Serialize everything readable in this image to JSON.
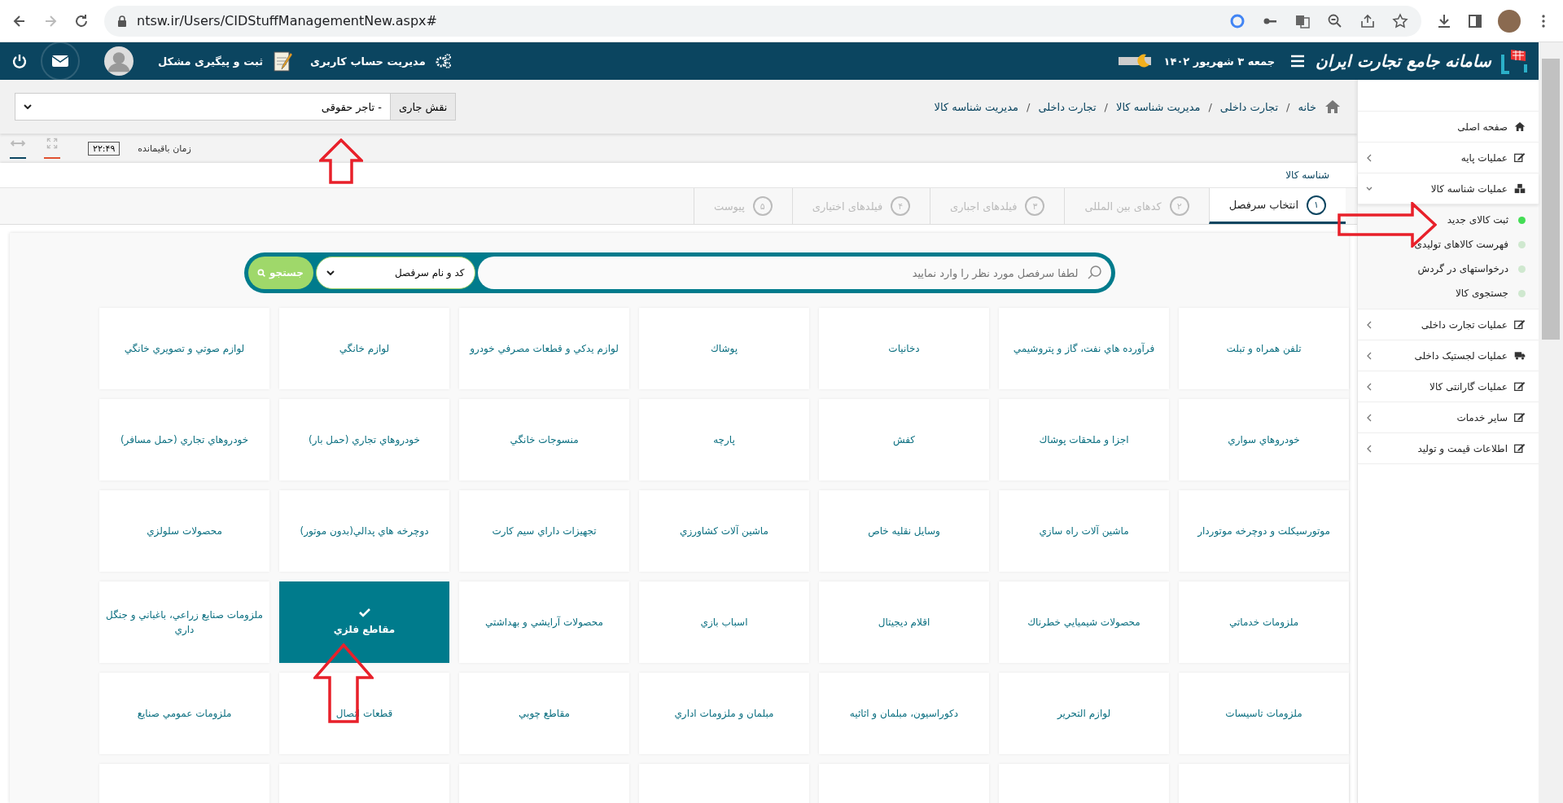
{
  "browser": {
    "url": "ntsw.ir/Users/CIDStuffManagementNew.aspx#"
  },
  "header": {
    "logo": "سامانه جامع تجارت ایران",
    "dark_mode": true,
    "date": "جمعه ۳ شهریور ۱۴۰۲",
    "links": [
      "مدیریت حساب کاربری",
      "ثبت و پیگیری مشکل"
    ]
  },
  "breadcrumb_separator": "/",
  "breadcrumb": [
    "خانه",
    "تجارت داخلی",
    "مدیریت شناسه کالا",
    "تجارت داخلی",
    "مدیریت شناسه کالا"
  ],
  "role": {
    "label": "نقش جاری",
    "value": "تاجر حقوقی -"
  },
  "timer": {
    "label": "زمان باقیمانده",
    "value": "۲۲:۴۹"
  },
  "panel_title": "شناسه کالا",
  "steps": [
    {
      "number": "١",
      "label": "انتخاب سرفصل",
      "selected": true
    },
    {
      "number": "۲",
      "label": "کدهای بین المللی",
      "selected": false
    },
    {
      "number": "۳",
      "label": "فیلدهای اجباری",
      "selected": false
    },
    {
      "number": "۴",
      "label": "فیلدهای اختیاری",
      "selected": false
    },
    {
      "number": "۵",
      "label": "پیوست",
      "selected": false
    }
  ],
  "search": {
    "placeholder": "لطفا سرفصل مورد نظر را وارد نمایید",
    "filter": "کد و نام سرفصل",
    "button": "جستجو"
  },
  "categories": [
    {
      "label": "تلفن همراه و تبلت",
      "selected": false
    },
    {
      "label": "فرآورده هاي نفت، گاز و پتروشيمي",
      "selected": false
    },
    {
      "label": "دخانيات",
      "selected": false
    },
    {
      "label": "پوشاك",
      "selected": false
    },
    {
      "label": "لوازم يدكي و قطعات مصرفي خودرو",
      "selected": false
    },
    {
      "label": "لوازم خانگي",
      "selected": false
    },
    {
      "label": "لوازم صوتي و تصويري خانگي",
      "selected": false
    },
    {
      "label": "خودروهاي سواري",
      "selected": false
    },
    {
      "label": "اجزا و ملحقات پوشاك",
      "selected": false
    },
    {
      "label": "كفش",
      "selected": false
    },
    {
      "label": "پارچه",
      "selected": false
    },
    {
      "label": "منسوجات خانگي",
      "selected": false
    },
    {
      "label": "خودروهاي تجاري (حمل بار)",
      "selected": false
    },
    {
      "label": "خودروهاي تجاري (حمل مسافر)",
      "selected": false
    },
    {
      "label": "موتورسيكلت و دوچرخه موتوردار",
      "selected": false
    },
    {
      "label": "ماشين آلات راه سازي",
      "selected": false
    },
    {
      "label": "وسايل نقليه خاص",
      "selected": false
    },
    {
      "label": "ماشين آلات كشاورزي",
      "selected": false
    },
    {
      "label": "تجهيزات داراي سيم كارت",
      "selected": false
    },
    {
      "label": "دوچرخه هاي پدالي(بدون موتور)",
      "selected": false
    },
    {
      "label": "محصولات سلولزي",
      "selected": false
    },
    {
      "label": "ملزومات خدماتي",
      "selected": false
    },
    {
      "label": "محصولات شيميايي خطرناك",
      "selected": false
    },
    {
      "label": "اقلام ديجيتال",
      "selected": false
    },
    {
      "label": "اسباب بازي",
      "selected": false
    },
    {
      "label": "محصولات آرايشي و بهداشتي",
      "selected": false
    },
    {
      "label": "مقاطع فلزي",
      "selected": true
    },
    {
      "label": "ملزومات صنايع زراعي، باغباني و جنگل داري",
      "selected": false
    },
    {
      "label": "ملزومات تاسيسات",
      "selected": false
    },
    {
      "label": "لوازم التحرير",
      "selected": false
    },
    {
      "label": "دكوراسيون، مبلمان و اثاثيه",
      "selected": false
    },
    {
      "label": "مبلمان و ملزومات اداري",
      "selected": false
    },
    {
      "label": "مقاطع چوبي",
      "selected": false
    },
    {
      "label": "قطعات اتصال",
      "selected": false
    },
    {
      "label": "ملزومات عمومي صنايع",
      "selected": false
    },
    {
      "selected": false
    },
    {
      "selected": false
    },
    {
      "selected": false
    },
    {
      "selected": false
    },
    {
      "selected": false
    },
    {
      "selected": false
    },
    {
      "selected": false
    }
  ],
  "sidebar": [
    {
      "label": "صفحه اصلی"
    },
    {
      "label": "عملیات پایه",
      "expanded": false
    },
    {
      "label": "عملیات شناسه کالا",
      "expanded": true,
      "children": [
        {
          "label": "ثبت کالای جدید",
          "selected": true
        },
        {
          "label": "فهرست کالاهای تولیدی",
          "selected": false
        },
        {
          "label": "درخواستهای در گردش",
          "selected": false
        },
        {
          "label": "جستجوی کالا",
          "selected": false
        }
      ]
    },
    {
      "label": "عملیات تجارت داخلی",
      "expanded": false
    },
    {
      "label": "عملیات لجستیک داخلی",
      "expanded": false
    },
    {
      "label": "عملیات گارانتی کالا",
      "expanded": false
    },
    {
      "label": "سایر خدمات",
      "expanded": false
    },
    {
      "label": "اطلاعات قیمت و تولید",
      "expanded": false
    }
  ]
}
